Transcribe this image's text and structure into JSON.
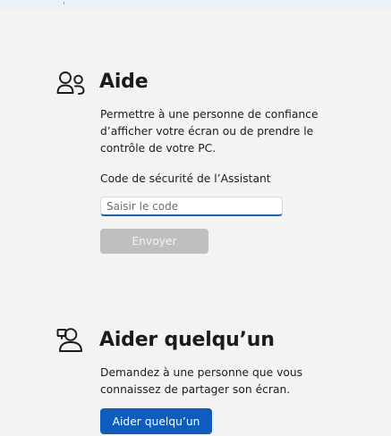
{
  "help_section": {
    "icon": "people-icon",
    "title": "Aide",
    "description": "Permettre à une personne de confiance d’afficher votre écran ou de prendre le contrôle de votre PC.",
    "code_label": "Code de sécurité de l’Assistant",
    "code_placeholder": "Saisir le code",
    "code_value": "",
    "submit_label": "Envoyer"
  },
  "assist_section": {
    "icon": "person-share-icon",
    "title": "Aider quelqu’un",
    "description": "Demandez à une personne que vous connaissez de partager son écran.",
    "button_label": "Aider quelqu’un"
  },
  "colors": {
    "background": "#f3f3f3",
    "accent": "#0f5cbf",
    "disabled_button": "#bfbfbf"
  }
}
